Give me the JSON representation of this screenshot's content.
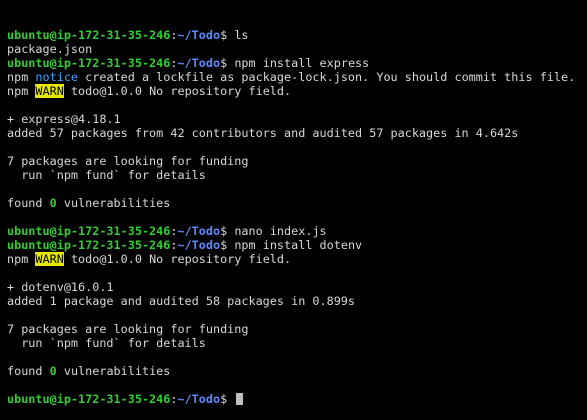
{
  "prompt": {
    "user_host": "ubuntu@ip-172-31-35-246",
    "colon": ":",
    "path": "~/Todo",
    "dollar": "$ "
  },
  "colors": {
    "background": "#000000",
    "text": "#d8d8d8",
    "user": "#32cd32",
    "path": "#5c8bff",
    "notice": "#3aa3ff",
    "warn_bg": "#e8e800"
  },
  "lines": [
    {
      "type": "prompt",
      "cmd": "ls"
    },
    {
      "type": "text",
      "text": "package.json"
    },
    {
      "type": "prompt",
      "cmd": "npm install express"
    },
    {
      "type": "npm",
      "level": "notice",
      "text": " created a lockfile as package-lock.json. You should commit this file."
    },
    {
      "type": "npm",
      "level": "WARN",
      "text": " todo@1.0.0 No repository field."
    },
    {
      "type": "blank"
    },
    {
      "type": "text",
      "text": "+ express@4.18.1"
    },
    {
      "type": "text",
      "text": "added 57 packages from 42 contributors and audited 57 packages in 4.642s"
    },
    {
      "type": "blank"
    },
    {
      "type": "text",
      "text": "7 packages are looking for funding"
    },
    {
      "type": "text",
      "text": "  run `npm fund` for details"
    },
    {
      "type": "blank"
    },
    {
      "type": "found",
      "pre": "found ",
      "count": "0",
      "post": " vulnerabilities"
    },
    {
      "type": "blank"
    },
    {
      "type": "prompt",
      "cmd": "nano index.js"
    },
    {
      "type": "prompt",
      "cmd": "npm install dotenv"
    },
    {
      "type": "npm",
      "level": "WARN",
      "text": " todo@1.0.0 No repository field."
    },
    {
      "type": "blank"
    },
    {
      "type": "text",
      "text": "+ dotenv@16.0.1"
    },
    {
      "type": "text",
      "text": "added 1 package and audited 58 packages in 0.899s"
    },
    {
      "type": "blank"
    },
    {
      "type": "text",
      "text": "7 packages are looking for funding"
    },
    {
      "type": "text",
      "text": "  run `npm fund` for details"
    },
    {
      "type": "blank"
    },
    {
      "type": "found",
      "pre": "found ",
      "count": "0",
      "post": " vulnerabilities"
    },
    {
      "type": "blank"
    },
    {
      "type": "prompt",
      "cmd": "",
      "cursor": true
    }
  ],
  "npm_prefix": "npm "
}
